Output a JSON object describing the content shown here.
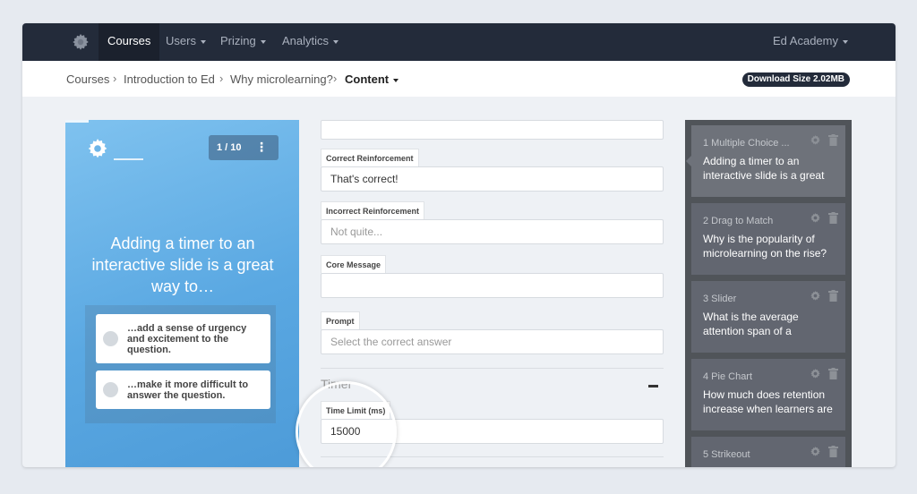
{
  "nav": {
    "items": [
      {
        "label": "Courses",
        "active": true,
        "dropdown": false
      },
      {
        "label": "Users",
        "active": false,
        "dropdown": true
      },
      {
        "label": "Prizing",
        "active": false,
        "dropdown": true
      },
      {
        "label": "Analytics",
        "active": false,
        "dropdown": true
      }
    ],
    "org": "Ed Academy",
    "logo_icon": "gear-logo-icon"
  },
  "breadcrumb": {
    "items": [
      "Courses",
      "Introduction to Ed",
      "Why microlearning?"
    ],
    "current": "Content",
    "separator": "›"
  },
  "download_size": "Download Size 2.02MB",
  "preview": {
    "counter": "1 / 10",
    "menu_icon": "⋮",
    "question": "Adding a timer to an interactive slide is a great way to…",
    "answers": [
      "…add a sense of urgency and excitement to the question.",
      "…make it more difficult to answer the question."
    ]
  },
  "form": {
    "correct_label": "Correct Reinforcement",
    "correct_value": "That's correct!",
    "incorrect_label": "Incorrect Reinforcement",
    "incorrect_placeholder": "Not quite...",
    "core_label": "Core Message",
    "core_value": "",
    "prompt_label": "Prompt",
    "prompt_placeholder": "Select the correct answer",
    "timer_section": "Timer",
    "time_limit_label": "Time Limit (ms)",
    "time_limit_value": "15000"
  },
  "slides": [
    {
      "meta": "1  Multiple Choice ...",
      "title": "Adding a timer to an interactive slide is a great",
      "active": true
    },
    {
      "meta": "2  Drag to Match",
      "title": "Why is the popularity of microlearning on the rise?",
      "active": false
    },
    {
      "meta": "3  Slider",
      "title": "What is the average attention span of a",
      "active": false
    },
    {
      "meta": "4  Pie Chart",
      "title": "How much does retention increase when learners are",
      "active": false
    },
    {
      "meta": "5  Strikeout",
      "title": "",
      "active": false
    }
  ],
  "colors": {
    "nav_bg": "#232b3a",
    "preview_blue": "#5aa8e2",
    "slides_bg": "#505459"
  }
}
